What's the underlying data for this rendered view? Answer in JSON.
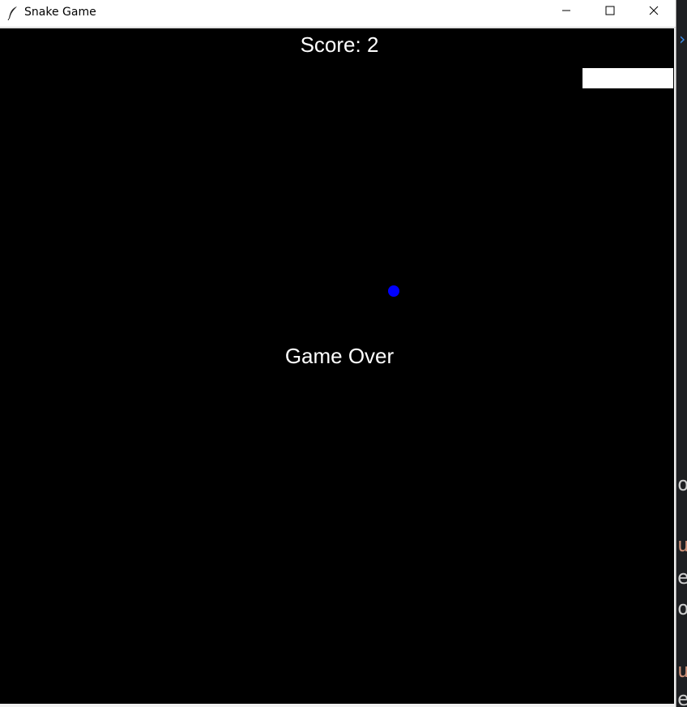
{
  "window": {
    "title": "Snake Game",
    "icon": "feather-icon"
  },
  "controls": {
    "minimize_icon": "minimize-icon",
    "maximize_icon": "maximize-icon",
    "close_icon": "close-icon"
  },
  "game": {
    "score_text": "Score: 2",
    "game_over_text": "Game Over",
    "colors": {
      "background": "#000000",
      "snake": "#ffffff",
      "food": "#0000ff",
      "text": "#ffffff"
    }
  },
  "background_editor": {
    "glyphs": [
      "o",
      "u",
      "e",
      "o",
      "u",
      "e"
    ]
  }
}
